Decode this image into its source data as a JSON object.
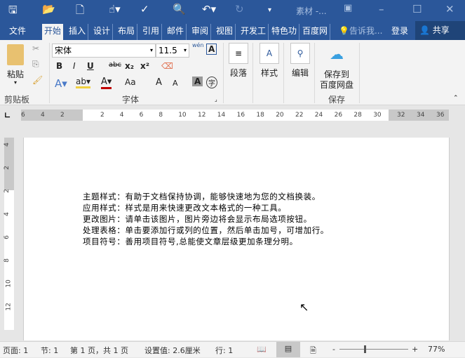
{
  "title": "素材 -...",
  "quick_access": [
    "save-icon",
    "open-icon",
    "new-icon",
    "touch-mode-icon",
    "spelling-icon",
    "print-preview-icon",
    "undo-icon",
    "redo-icon",
    "customize-icon"
  ],
  "tabs": [
    {
      "label": "文件"
    },
    {
      "label": "开始"
    },
    {
      "label": "插入"
    },
    {
      "label": "设计"
    },
    {
      "label": "布局"
    },
    {
      "label": "引用"
    },
    {
      "label": "邮件"
    },
    {
      "label": "审阅"
    },
    {
      "label": "视图"
    },
    {
      "label": "开发工"
    },
    {
      "label": "特色功"
    },
    {
      "label": "百度网"
    }
  ],
  "tell_me": "告诉我...",
  "login": "登录",
  "share": "共享",
  "ribbon": {
    "clipboard": {
      "paste": "粘贴",
      "label": "剪贴板"
    },
    "font": {
      "name": "宋体",
      "size": "11.5",
      "label": "字体",
      "bold": "B",
      "italic": "I",
      "underline": "U",
      "strike": "abc",
      "sub": "x₂",
      "sup": "x²",
      "case": "Aa",
      "grow": "A",
      "shrink": "A",
      "phonetic": "wén",
      "border_char": "A",
      "shade_char": "A",
      "enclose": "字"
    },
    "paragraph": {
      "label": "段落"
    },
    "styles": {
      "label": "样式"
    },
    "editing": {
      "label": "编辑"
    },
    "save": {
      "button": "保存到百度网盘",
      "btn_line1": "保存到",
      "btn_line2": "百度网盘",
      "label": "保存"
    }
  },
  "ruler": {
    "left": [
      "6",
      "4",
      "2"
    ],
    "main": [
      "2",
      "4",
      "6",
      "8",
      "10",
      "12",
      "14",
      "16",
      "18",
      "20",
      "22",
      "24",
      "26",
      "28",
      "30"
    ],
    "right": [
      "32",
      "34",
      "36"
    ],
    "vertical": [
      "4",
      "2",
      "2",
      "4",
      "6",
      "8",
      "10",
      "12"
    ]
  },
  "document": {
    "lines": [
      "主题样式：有助于文档保持协调，能够快速地为您的文档换装。",
      "应用样式：样式是用来快速更改文本格式的一种工具。",
      "更改图片：请单击该图片，图片旁边将会显示布局选项按钮。",
      "处理表格：单击要添加行或列的位置，然后单击加号，可增加行。",
      "项目符号：善用项目符号,总能使文章层级更加条理分明。"
    ]
  },
  "status": {
    "page": "页面: 1",
    "section": "节: 1",
    "page_of": "第 1 页，共 1 页",
    "setting": "设置值: 2.6厘米",
    "row": "行: 1",
    "zoom": "77%",
    "zoom_minus": "-",
    "zoom_plus": "+"
  },
  "colors": {
    "brand": "#2b579a",
    "ribbon": "#f3f3f3"
  }
}
